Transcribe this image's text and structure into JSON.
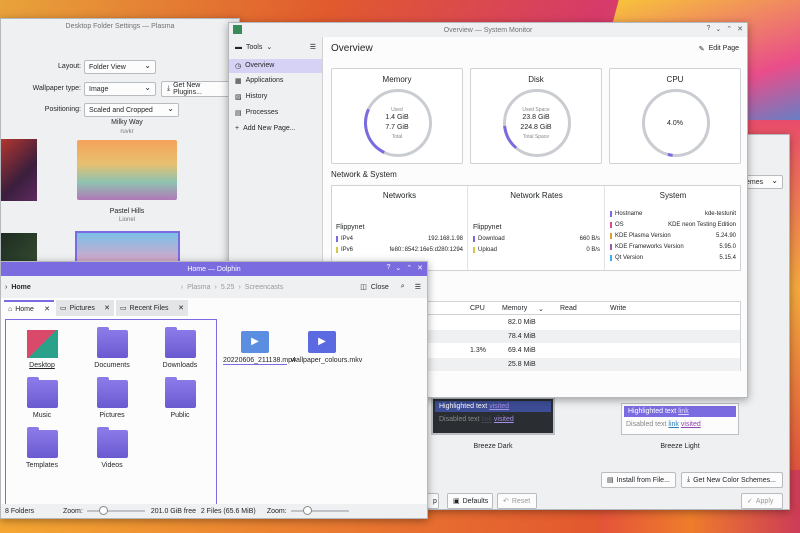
{
  "wallpaper_settings": {
    "title": "Desktop Folder Settings — Plasma",
    "layout_label": "Layout:",
    "layout_value": "Folder View",
    "wallpaper_type_label": "Wallpaper type:",
    "wallpaper_type_value": "Image",
    "get_new_plugins": "Get New Plugins...",
    "positioning_label": "Positioning:",
    "positioning_value": "Scaled and Cropped",
    "wallpapers": [
      {
        "name": "Milky Way",
        "author": "ruvkr"
      },
      {
        "name": "Pastel Hills",
        "author": "Lionel"
      }
    ]
  },
  "system_monitor": {
    "title": "Overview — System Monitor",
    "tools_label": "Tools",
    "nav": [
      "Overview",
      "Applications",
      "History",
      "Processes",
      "Add New Page..."
    ],
    "page_title": "Overview",
    "edit_page": "Edit Page",
    "memory": {
      "title": "Memory",
      "label1": "Used",
      "value1": "1.4 GiB",
      "value2": "7.7 GiB",
      "label2": "Total",
      "fraction": 0.18
    },
    "disk": {
      "title": "Disk",
      "label1": "Used Space",
      "value1": "23.8 GiB",
      "value2": "224.8 GiB",
      "label2": "Total Space",
      "fraction": 0.11
    },
    "cpu": {
      "title": "CPU",
      "value": "4.0%",
      "fraction": 0.04
    },
    "section_network": "Network & System",
    "networks": {
      "title": "Networks",
      "name": "Flippynet",
      "rows": [
        {
          "k": "IPv4",
          "v": "192.168.1.98"
        },
        {
          "k": "IPv6",
          "v": "fe80::8542:16e5:d280:1294"
        }
      ]
    },
    "rates": {
      "title": "Network Rates",
      "name": "Flippynet",
      "rows": [
        {
          "k": "Download",
          "v": "660 B/s"
        },
        {
          "k": "Upload",
          "v": "0 B/s"
        }
      ]
    },
    "system": {
      "title": "System",
      "rows": [
        {
          "k": "Hostname",
          "v": "kde-testunit"
        },
        {
          "k": "OS",
          "v": "KDE neon Testing Edition"
        },
        {
          "k": "KDE Plasma Version",
          "v": "5.24.90"
        },
        {
          "k": "KDE Frameworks Version",
          "v": "5.95.0"
        },
        {
          "k": "Qt Version",
          "v": "5.15.4"
        }
      ]
    },
    "proc_headers": [
      "CPU",
      "Memory",
      "Read",
      "Write"
    ],
    "proc_rows": [
      {
        "cpu": "",
        "mem": "82.0 MiB"
      },
      {
        "cpu": "",
        "mem": "78.4 MiB"
      },
      {
        "cpu": "1.3%",
        "mem": "69.4 MiB"
      },
      {
        "cpu": "",
        "mem": "25.8 MiB"
      }
    ]
  },
  "colors_win": {
    "schemes_label": "emes",
    "dark": {
      "name": "Breeze Dark",
      "highlighted": "Highlighted text",
      "visited": "visited",
      "disabled": "Disabled text",
      "link": "link"
    },
    "light": {
      "name": "Breeze Light",
      "highlighted": "Highlighted text",
      "link": "link",
      "disabled": "Disabled text",
      "visited": "visited"
    },
    "install_from_file": "Install from File...",
    "get_new_schemes": "Get New Color Schemes...",
    "defaults": "Defaults",
    "reset": "Reset",
    "apply": "Apply",
    "partial_btn": "p"
  },
  "dolphin": {
    "title": "Home — Dolphin",
    "location": "Home",
    "breadcrumb": [
      "Plasma",
      "5.25",
      "Screencasts"
    ],
    "close_label": "Close",
    "tabs": [
      "Home",
      "Pictures",
      "Recent Files"
    ],
    "left_items": [
      "Desktop",
      "Documents",
      "Downloads",
      "Music",
      "Pictures",
      "Public",
      "Templates",
      "Videos"
    ],
    "right_items": [
      "20220606_211138.mp4",
      "wallpaper_colours.mkv"
    ],
    "left_status": "8 Folders",
    "zoom_label": "Zoom:",
    "free_space": "201.0 GiB free",
    "right_status": "2 Files (65.6 MiB)"
  }
}
